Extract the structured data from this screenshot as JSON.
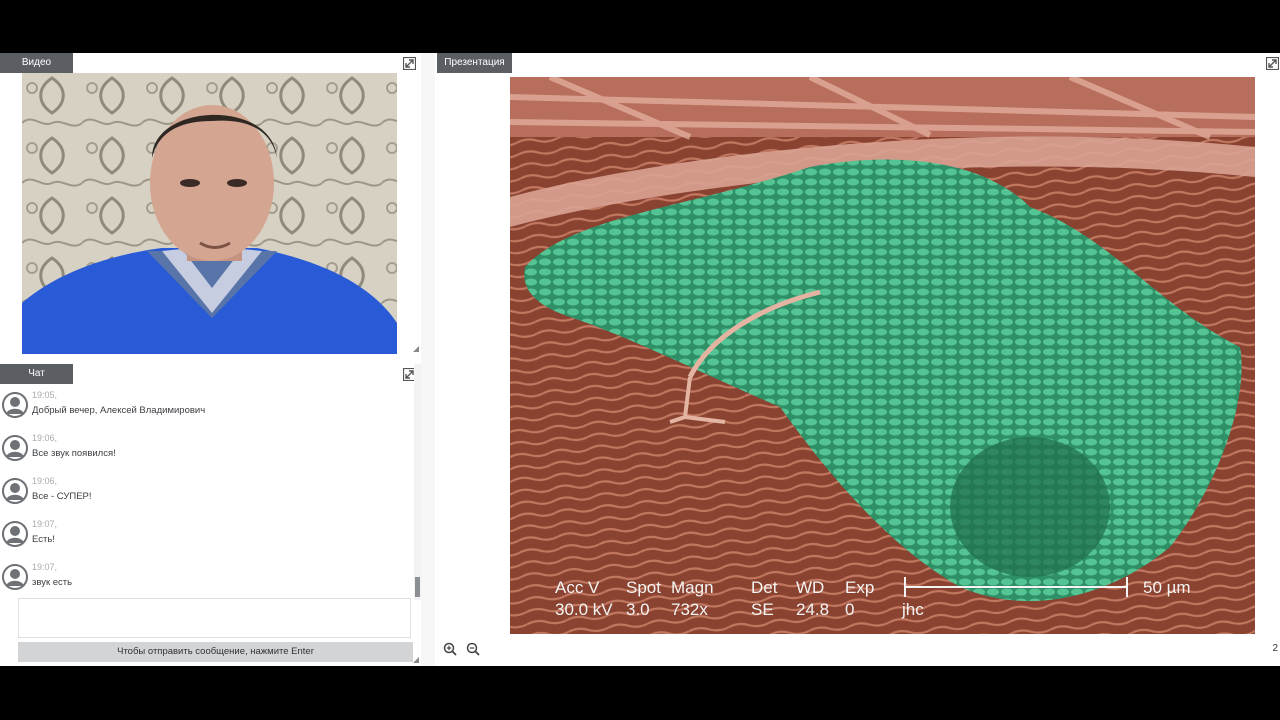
{
  "video_panel": {
    "title": "Видео"
  },
  "chat_panel": {
    "title": "Чат",
    "messages": [
      {
        "time": "19:05,",
        "text": "Добрый вечер, Алексей Владимирович"
      },
      {
        "time": "19:06,",
        "text": "Все звук появился!"
      },
      {
        "time": "19:06,",
        "text": "Все - СУПЕР!"
      },
      {
        "time": "19:07,",
        "text": "Есть!"
      },
      {
        "time": "19:07,",
        "text": "звук есть"
      }
    ],
    "input_value": "",
    "send_hint": "Чтобы отправить сообщение, нажмите Enter"
  },
  "presentation_panel": {
    "title": "Презентация",
    "page_number": "2",
    "slide_labels": {
      "accv_label": "Acc V",
      "accv_value": "30.0 kV",
      "spot_label": "Spot",
      "spot_value": "3.0",
      "magn_label": "Magn",
      "magn_value": "732x",
      "det_label": "Det",
      "det_value": "SE",
      "wd_label": "WD",
      "wd_value": "24.8",
      "exp_label": "Exp",
      "exp_value": "0",
      "author": "jhc",
      "scale_label": "50 µm"
    }
  },
  "icons": {
    "expand": "expand-icon",
    "zoom_in": "zoom-in-icon",
    "zoom_out": "zoom-out-icon",
    "avatar": "user-avatar-icon"
  },
  "colors": {
    "tab_bg": "#5b5e63",
    "send_bar_bg": "#d3d4d6",
    "accent_green": "#3aa57a",
    "tissue": "#9a4b38"
  }
}
